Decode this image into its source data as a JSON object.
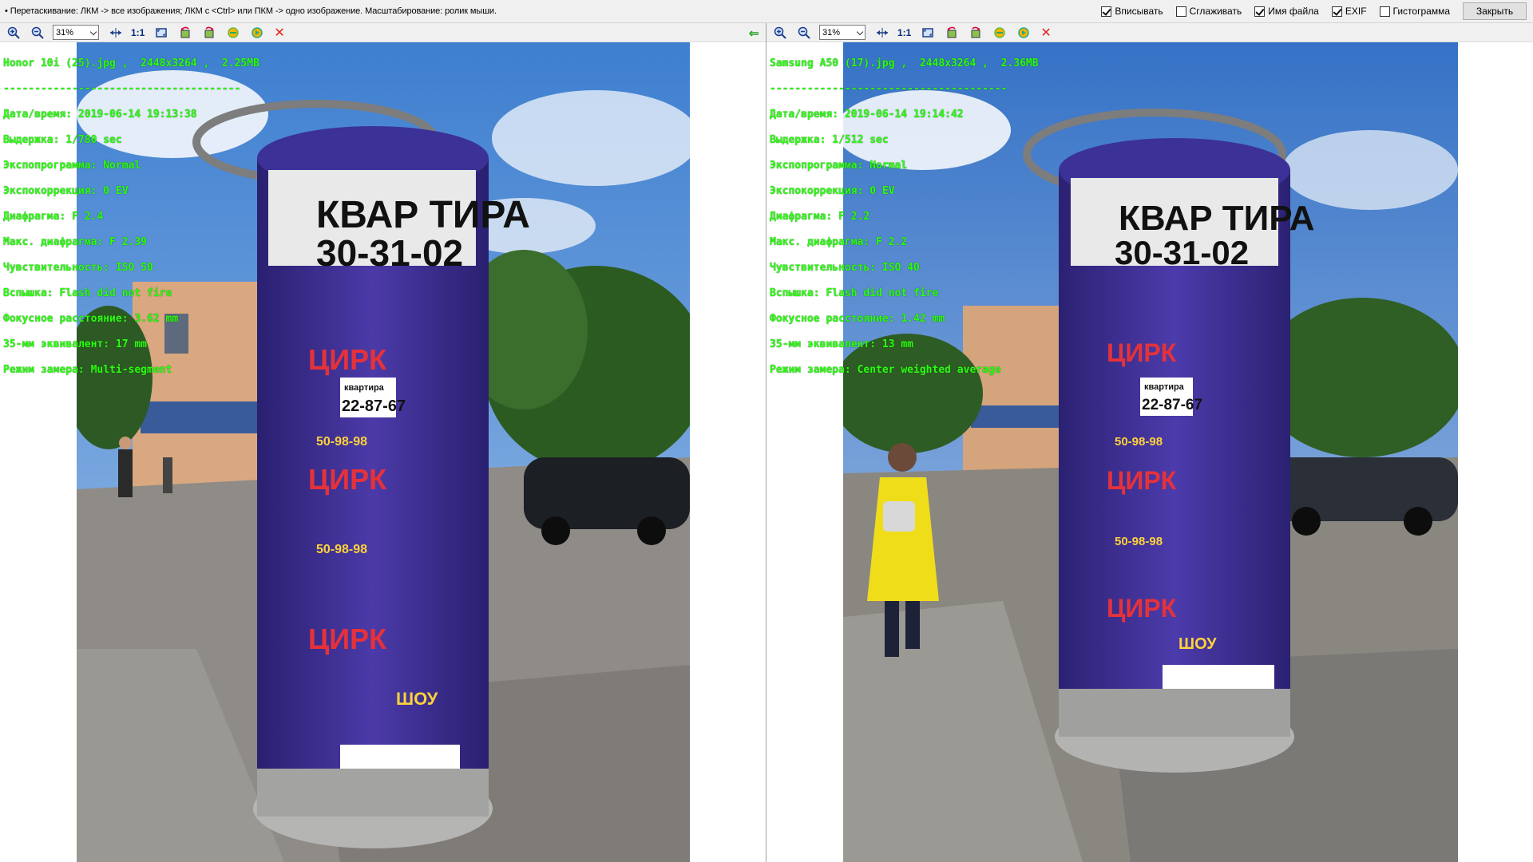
{
  "topbar": {
    "hint": "• Перетаскивание: ЛКМ -> все изображения; ЛКМ с <Ctrl> или ПКМ -> одно изображение. Масштабирование: ролик мыши.",
    "options": [
      {
        "label": "Вписывать",
        "checked": true
      },
      {
        "label": "Сглаживать",
        "checked": false
      },
      {
        "label": "Имя файла",
        "checked": true
      },
      {
        "label": "EXIF",
        "checked": true
      },
      {
        "label": "Гистограмма",
        "checked": false
      }
    ],
    "close_label": "Закрыть"
  },
  "panes": [
    {
      "zoom": "31%",
      "one_to_one": "1:1",
      "exif": {
        "filename": "Honor 10i (25).jpg ,  2448x3264 ,  2.25MB",
        "separator": "--------------------------------------",
        "datetime": "Дата/время: 2019-06-14 19:13:38",
        "exposure": "Выдержка: 1/780 sec",
        "program": "Экспопрограмма: Normal",
        "comp": "Экспокоррекция: 0 EV",
        "aperture": "Диафрагма: F 2.4",
        "max_aperture": "Макс. диафрагма: F 2.39",
        "iso": "Чувствительность: ISO 50",
        "flash": "Вспышка: Flash did not fire",
        "focal": "Фокусное расстояние: 3.62 mm",
        "equiv": "35-мм эквивалент: 17 mm",
        "metering": "Режим замера: Multi-segment"
      },
      "poster_text": {
        "top": "КВАР ТИРА",
        "phone": "30-31-02",
        "kvartira": "квартира",
        "phone2": "22-87-67",
        "circus": "ЦИРК",
        "phone3": "50-98-98",
        "show": "ШОУ"
      }
    },
    {
      "zoom": "31%",
      "one_to_one": "1:1",
      "exif": {
        "filename": "Samsung A50 (17).jpg ,  2448x3264 ,  2.36MB",
        "separator": "--------------------------------------",
        "datetime": "Дата/время: 2019-06-14 19:14:42",
        "exposure": "Выдержка: 1/512 sec",
        "program": "Экспопрограмма: Normal",
        "comp": "Экспокоррекция: 0 EV",
        "aperture": "Диафрагма: F 2.2",
        "max_aperture": "Макс. диафрагма: F 2.2",
        "iso": "Чувствительность: ISO 40",
        "flash": "Вспышка: Flash did not fire",
        "focal": "Фокусное расстояние: 1.42 mm",
        "equiv": "35-мм эквивалент: 13 mm",
        "metering": "Режим замера: Center weighted average"
      },
      "poster_text": {
        "top": "КВАР ТИРА",
        "phone": "30-31-02",
        "kvartira": "квартира",
        "phone2": "22-87-67",
        "circus": "ЦИРК",
        "phone3": "50-98-98",
        "show": "ШОУ"
      }
    }
  ],
  "colors": {
    "exif_text": "#2dfc13",
    "sky": "#4d8fd8",
    "asphalt": "#8e8a85",
    "column_posters": "#3a2a8a",
    "delete_icon": "#e0241a",
    "arrow_icon": "#1b9e1b"
  }
}
